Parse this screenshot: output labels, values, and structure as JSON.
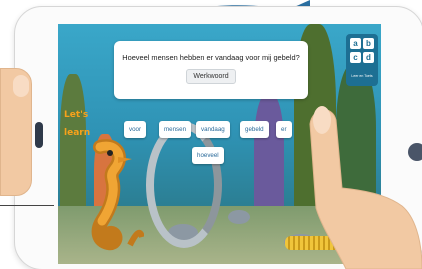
{
  "app": {
    "logo_text": "Let's learn"
  },
  "question": {
    "text": "Hoeveel mensen hebben er vandaag voor mij gebeld?",
    "category_button": "Werkwoord"
  },
  "word_tiles": [
    "voor",
    "mensen",
    "vandaag",
    "gebeld",
    "er",
    "hoeveel"
  ],
  "mode_panel": {
    "tiles": [
      "a",
      "b",
      "c",
      "d"
    ],
    "label": "Leer en Toets"
  },
  "colors": {
    "accent": "#1d6f93",
    "word_text": "#2a6a9a",
    "logo": "#f7a21b"
  }
}
